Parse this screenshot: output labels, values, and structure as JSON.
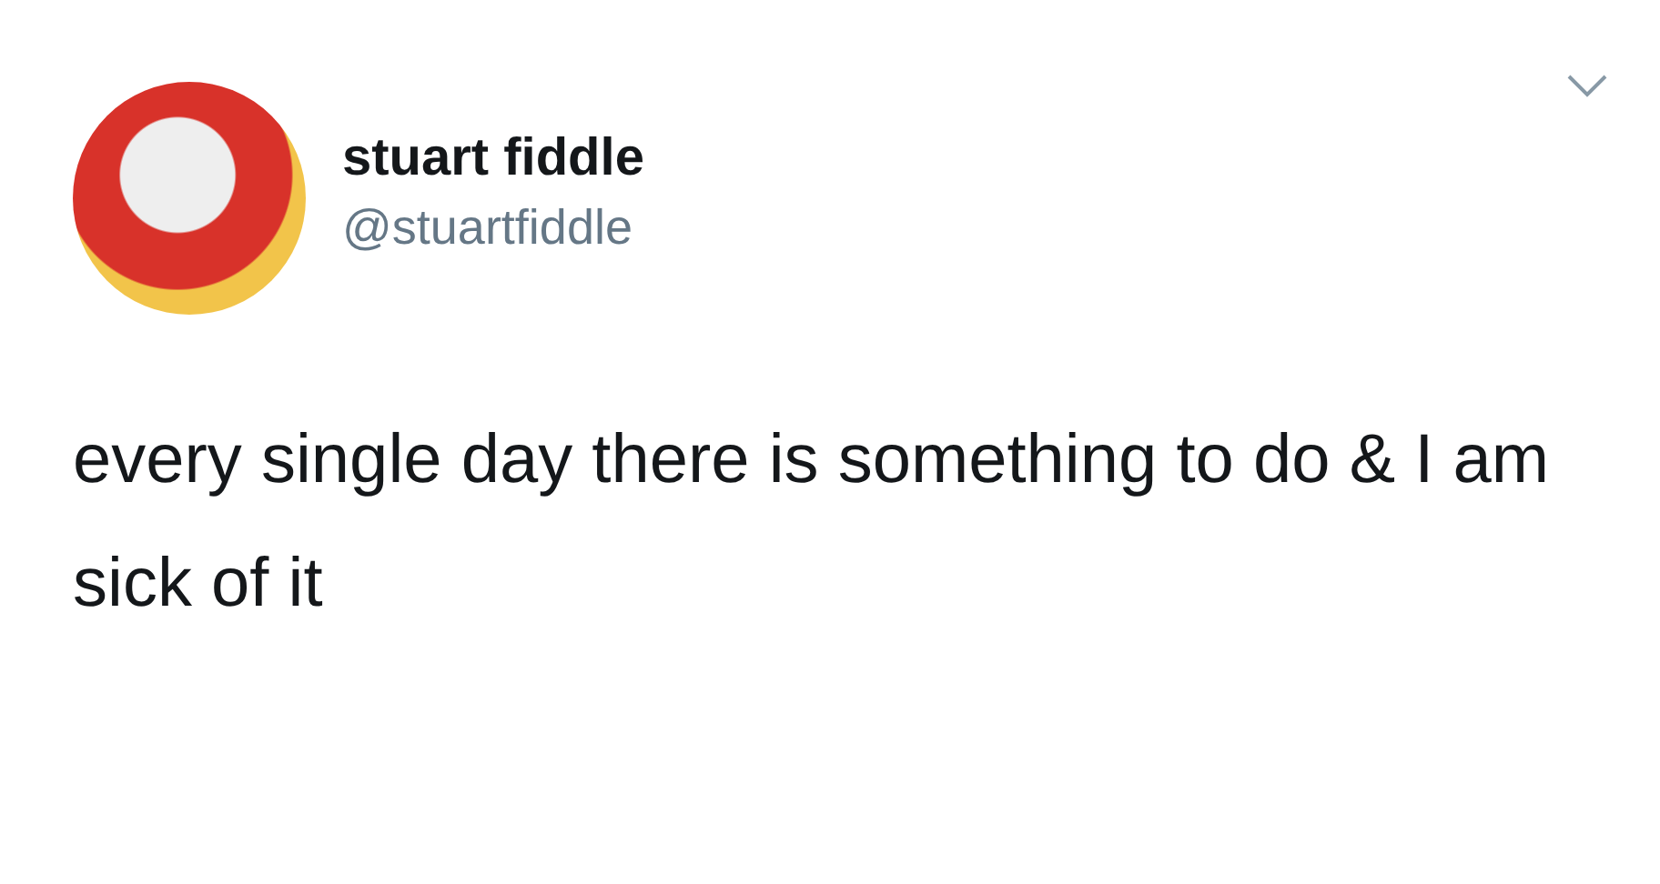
{
  "tweet": {
    "author": {
      "name": "stuart fiddle",
      "handle": "@stuartfiddle"
    },
    "text": "every single day there is something to do & I am sick of it"
  }
}
